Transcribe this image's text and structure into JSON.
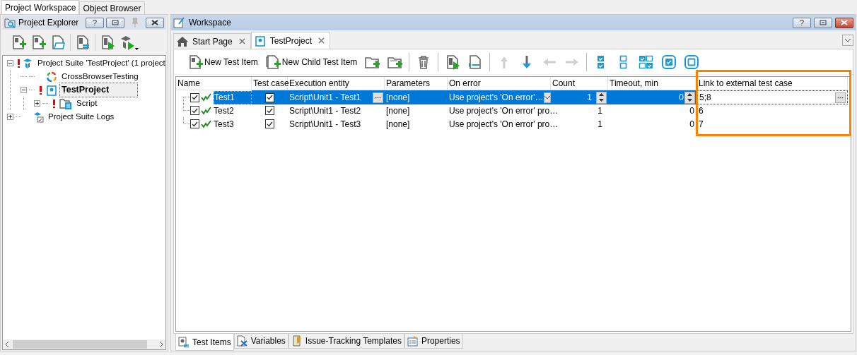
{
  "top_tabs": [
    {
      "label": "Project Workspace",
      "selected": true
    },
    {
      "label": "Object Browser",
      "selected": false
    }
  ],
  "explorer": {
    "title": "Project Explorer",
    "help_label": "?",
    "tree": [
      {
        "label": "Project Suite 'TestProject' (1 project",
        "kind": "suite",
        "expanded": true,
        "error": true,
        "selected": false,
        "children": [
          {
            "label": "CrossBrowserTesting",
            "kind": "cbt",
            "error": false,
            "selected": false
          },
          {
            "label": "TestProject",
            "kind": "project",
            "expanded": true,
            "error": true,
            "selected": true,
            "children": [
              {
                "label": "Script",
                "kind": "script",
                "expanded": false,
                "error": true,
                "selected": false
              }
            ]
          }
        ]
      },
      {
        "label": "Project Suite Logs",
        "kind": "logs",
        "expanded": false,
        "error": false,
        "selected": false
      }
    ]
  },
  "workspace": {
    "title": "Workspace",
    "help_label": "?",
    "doc_tabs": [
      {
        "label": "Start Page",
        "kind": "home",
        "selected": false
      },
      {
        "label": "TestProject",
        "kind": "project",
        "selected": true
      }
    ],
    "toolbar": [
      {
        "kind": "new-item",
        "label": "New Test Item",
        "disabled": false
      },
      {
        "kind": "new-child",
        "label": "New Child Test Item",
        "disabled": false
      },
      {
        "kind": "add-folder",
        "disabled": false
      },
      {
        "kind": "add-child-folder",
        "disabled": false
      },
      {
        "kind": "separator"
      },
      {
        "kind": "delete",
        "disabled": false
      },
      {
        "kind": "separator"
      },
      {
        "kind": "run",
        "disabled": false
      },
      {
        "kind": "run-selected",
        "disabled": false
      },
      {
        "kind": "separator"
      },
      {
        "kind": "up",
        "disabled": true
      },
      {
        "kind": "down",
        "disabled": false
      },
      {
        "kind": "left",
        "disabled": true
      },
      {
        "kind": "right",
        "disabled": true
      },
      {
        "kind": "separator"
      },
      {
        "kind": "check-all",
        "disabled": false
      },
      {
        "kind": "uncheck-all",
        "disabled": false
      },
      {
        "kind": "invert",
        "disabled": false
      },
      {
        "kind": "check-one",
        "disabled": false
      },
      {
        "kind": "uncheck-one",
        "disabled": false
      }
    ],
    "table": {
      "columns": [
        "Name",
        "Test case",
        "Execution entity",
        "Parameters",
        "On error",
        "Count",
        "Timeout, min",
        "Link to external test case"
      ],
      "highlight_frame": true,
      "rows": [
        {
          "name": "Test1",
          "enabled": true,
          "test_case": true,
          "entity": "Script\\Unit1 - Test1",
          "parameters": "[none]",
          "on_error": "Use project's 'On error'…",
          "count": "1",
          "timeout": "0",
          "link": "5;8",
          "selected": true
        },
        {
          "name": "Test2",
          "enabled": true,
          "test_case": true,
          "entity": "Script\\Unit1 - Test2",
          "parameters": "[none]",
          "on_error": "Use project's 'On error' pro…",
          "count": "1",
          "timeout": "0",
          "link": "6",
          "selected": false
        },
        {
          "name": "Test3",
          "enabled": true,
          "test_case": true,
          "entity": "Script\\Unit1 - Test3",
          "parameters": "[none]",
          "on_error": "Use project's 'On error' pro…",
          "count": "1",
          "timeout": "0",
          "link": "7",
          "selected": false
        }
      ]
    },
    "bottom_tabs": [
      {
        "label": "Test Items",
        "kind": "items",
        "selected": true
      },
      {
        "label": "Variables",
        "kind": "variables",
        "selected": false
      },
      {
        "label": "Issue-Tracking Templates",
        "kind": "issues",
        "selected": false
      },
      {
        "label": "Properties",
        "kind": "properties",
        "selected": false
      }
    ]
  }
}
